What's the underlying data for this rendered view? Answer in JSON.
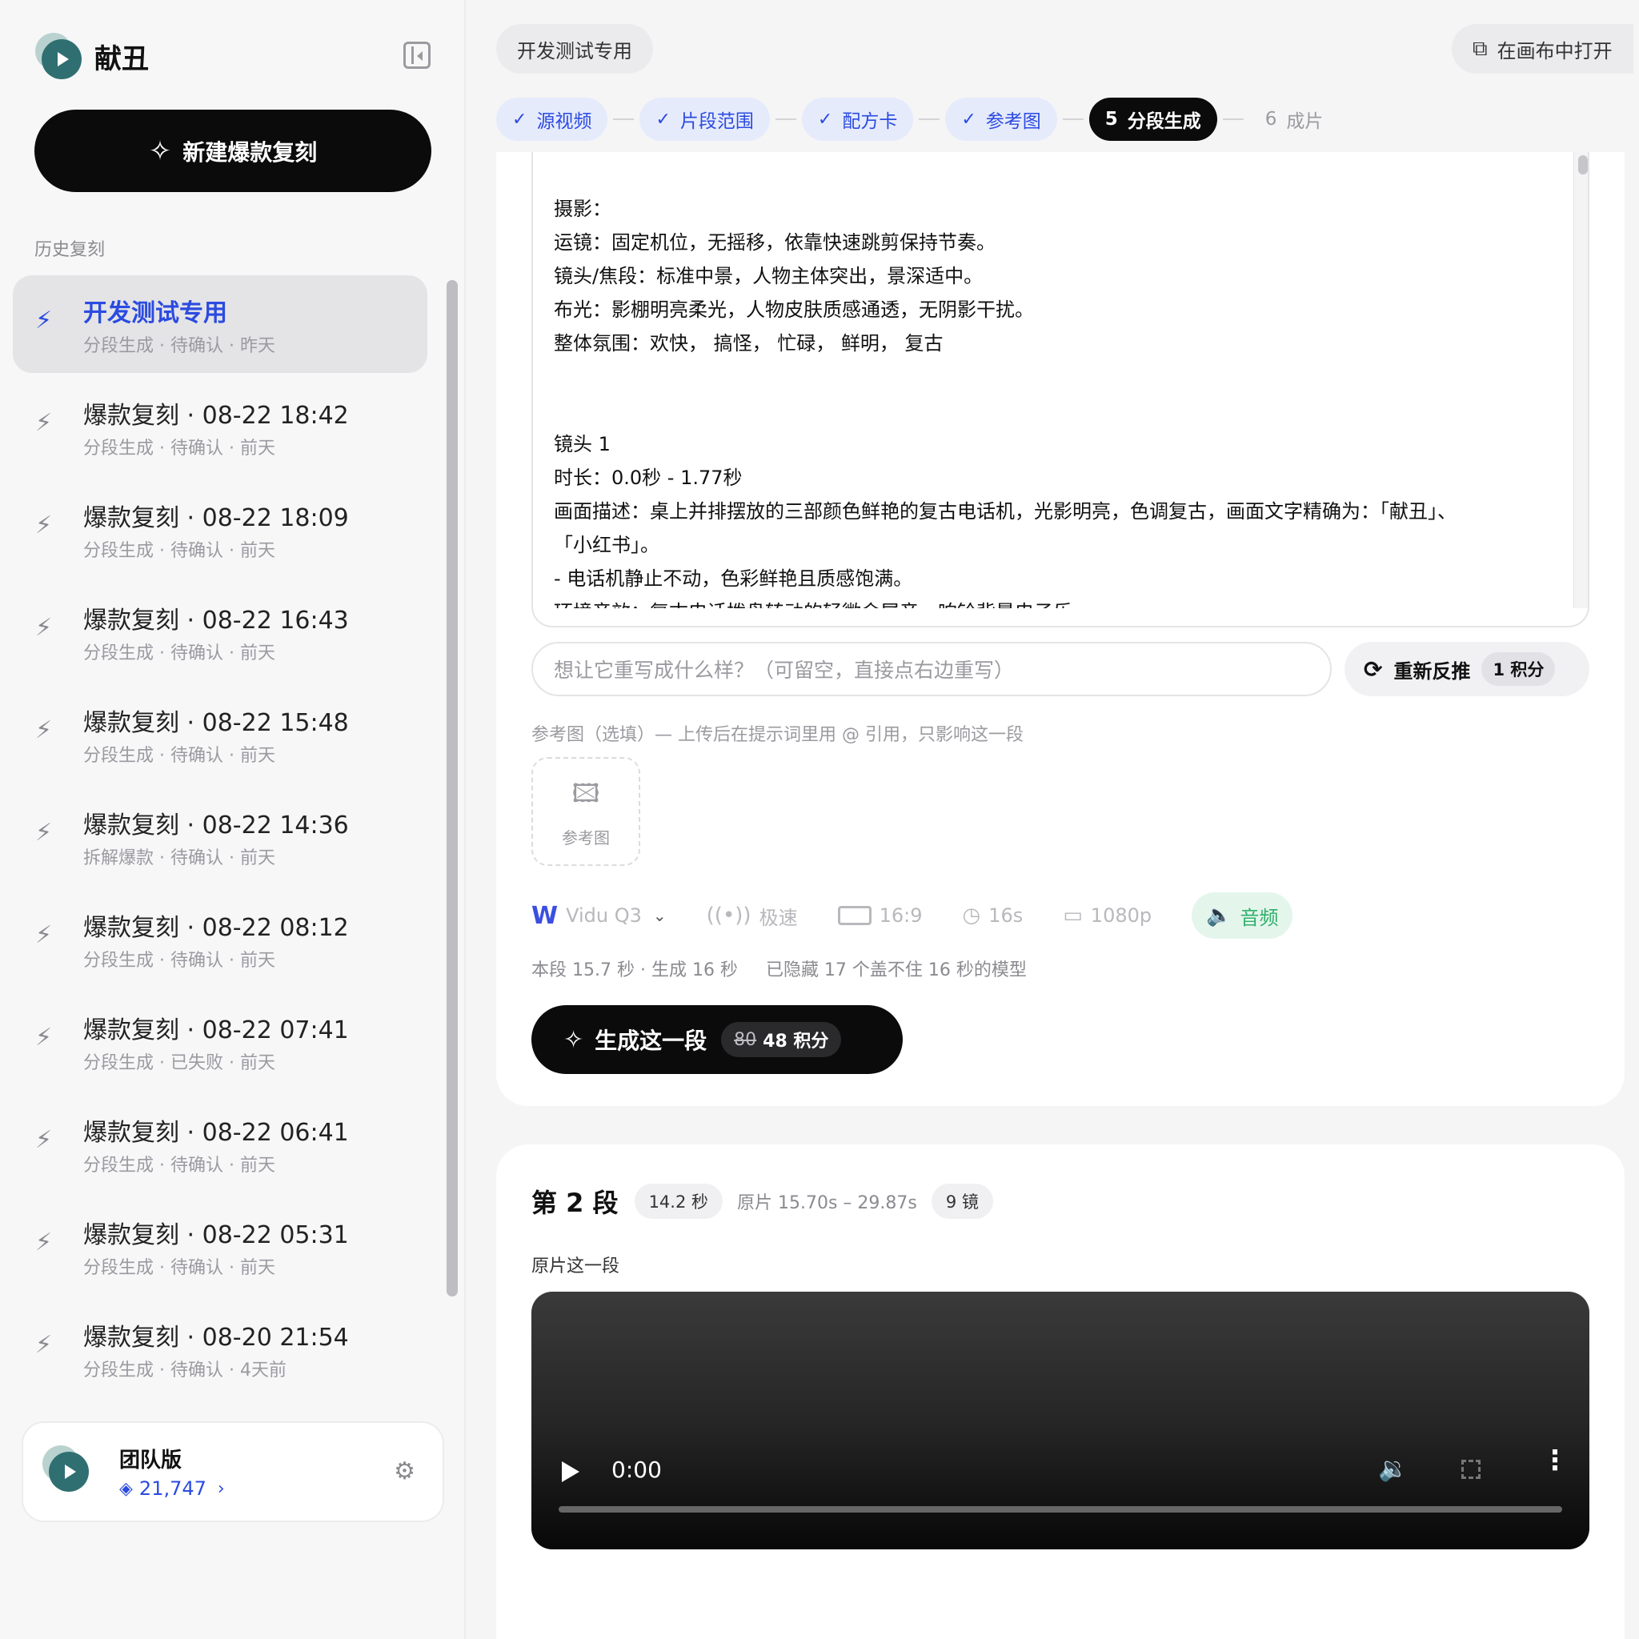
{
  "brand": {
    "name": "献丑"
  },
  "sidebar": {
    "new_button": "新建爆款复刻",
    "section_label": "历史复刻",
    "items": [
      {
        "title": "开发测试专用",
        "sub": "分段生成 · 待确认 · 昨天"
      },
      {
        "title": "爆款复刻 · 08-22 18:42",
        "sub": "分段生成 · 待确认 · 前天"
      },
      {
        "title": "爆款复刻 · 08-22 18:09",
        "sub": "分段生成 · 待确认 · 前天"
      },
      {
        "title": "爆款复刻 · 08-22 16:43",
        "sub": "分段生成 · 待确认 · 前天"
      },
      {
        "title": "爆款复刻 · 08-22 15:48",
        "sub": "分段生成 · 待确认 · 前天"
      },
      {
        "title": "爆款复刻 · 08-22 14:36",
        "sub": "拆解爆款 · 待确认 · 前天"
      },
      {
        "title": "爆款复刻 · 08-22 08:12",
        "sub": "分段生成 · 待确认 · 前天"
      },
      {
        "title": "爆款复刻 · 08-22 07:41",
        "sub": "分段生成 · 已失败 · 前天"
      },
      {
        "title": "爆款复刻 · 08-22 06:41",
        "sub": "分段生成 · 待确认 · 前天"
      },
      {
        "title": "爆款复刻 · 08-22 05:31",
        "sub": "分段生成 · 待确认 · 前天"
      },
      {
        "title": "爆款复刻 · 08-20 21:54",
        "sub": "分段生成 · 待确认 · 4天前"
      }
    ],
    "team": {
      "name": "团队版",
      "credits": "21,747"
    }
  },
  "header": {
    "project": "开发测试专用",
    "open_canvas": "在画布中打开"
  },
  "steps": [
    {
      "label": "源视频",
      "state": "done"
    },
    {
      "label": "片段范围",
      "state": "done"
    },
    {
      "label": "配方卡",
      "state": "done"
    },
    {
      "label": "参考图",
      "state": "done"
    },
    {
      "num": "5",
      "label": "分段生成",
      "state": "current"
    },
    {
      "num": "6",
      "label": "成片",
      "state": "todo"
    }
  ],
  "prompt": {
    "lines": [
      "摄影：",
      "运镜：固定机位，无摇移，依靠快速跳剪保持节奏。",
      "镜头/焦段：标准中景，人物主体突出，景深适中。",
      "布光：影棚明亮柔光，人物皮肤质感通透，无阴影干扰。",
      "整体氛围：欢快， 搞怪， 忙碌， 鲜明， 复古",
      "",
      "",
      "镜头 1",
      "时长：0.0秒 - 1.77秒",
      "画面描述：桌上并排摆放的三部颜色鲜艳的复古电话机，光影明亮，色调复古，画面文字精确为：「献丑」、",
      "「小红书」。",
      "- 电话机静止不动，色彩鲜艳且质感饱满。",
      "环境音效：复古电话拨盘转动的轻微金属音，响铃背景电子乐"
    ]
  },
  "rewrite": {
    "placeholder": "想让它重写成什么样？（可留空，直接点右边重写）",
    "button": "重新反推",
    "cost": "1 积分"
  },
  "reference": {
    "hint": "参考图（选填）— 上传后在提示词里用 @ 引用，只影响这一段",
    "upload_label": "参考图"
  },
  "options": {
    "model": "Vidu Q3",
    "speed": "极速",
    "ratio": "16:9",
    "duration": "16s",
    "resolution": "1080p",
    "audio": "音频"
  },
  "segment_note": {
    "main": "本段 15.7 秒 · 生成 16 秒",
    "hidden": "已隐藏 17 个盖不住 16 秒的模型"
  },
  "generate": {
    "label": "生成这一段",
    "old_cost": "80",
    "cost": "48 积分"
  },
  "segment2": {
    "title": "第 2 段",
    "duration": "14.2 秒",
    "range": "原片 15.70s – 29.87s",
    "shots": "9 镜",
    "label": "原片这一段",
    "time": "0:00"
  }
}
